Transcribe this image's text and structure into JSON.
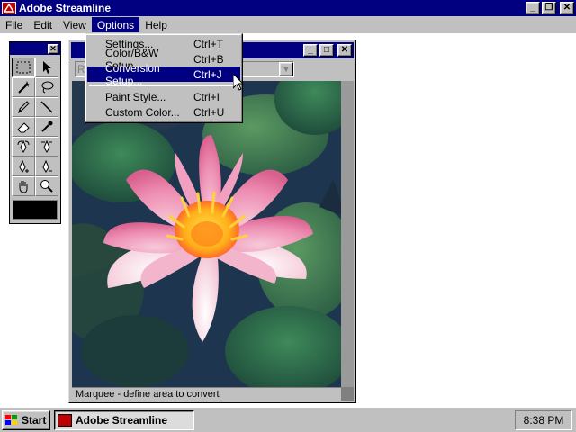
{
  "app": {
    "title": "Adobe Streamline",
    "minimize_glyph": "_",
    "restore_glyph": "❐",
    "close_glyph": "✕"
  },
  "menubar": {
    "items": [
      {
        "label": "File"
      },
      {
        "label": "Edit"
      },
      {
        "label": "View"
      },
      {
        "label": "Options",
        "active": true
      },
      {
        "label": "Help"
      }
    ]
  },
  "options_menu": {
    "items": [
      {
        "label": "Settings...",
        "shortcut": "Ctrl+T"
      },
      {
        "label": "Color/B&W Setup...",
        "shortcut": "Ctrl+B"
      },
      {
        "label": "Conversion Setup...",
        "shortcut": "Ctrl+J",
        "highlighted": true
      },
      {
        "label": "Paint Style...",
        "shortcut": "Ctrl+I"
      },
      {
        "label": "Custom Color...",
        "shortcut": "Ctrl+U"
      }
    ]
  },
  "tool_palette": {
    "tools": [
      "marquee-tool-icon",
      "arrow-select-icon",
      "magic-wand-icon",
      "lasso-icon",
      "pencil-icon",
      "line-tool-icon",
      "eraser-icon",
      "eyedropper-icon",
      "pen-convert-icon",
      "pen-convert-alt-icon",
      "pen-add-point-icon",
      "pen-remove-point-icon",
      "hand-tool-icon",
      "zoom-icon"
    ],
    "selected_tool": "marquee-tool-icon",
    "current_color": "#000000"
  },
  "document": {
    "combo_value": "R",
    "status_text": "Marquee - define area to convert"
  },
  "taskbar": {
    "start_label": "Start",
    "task_label": "Adobe Streamline",
    "clock": "8:38 PM"
  },
  "colors": {
    "titlebar": "#000080",
    "face": "#c0c0c0",
    "highlight": "#000080"
  }
}
